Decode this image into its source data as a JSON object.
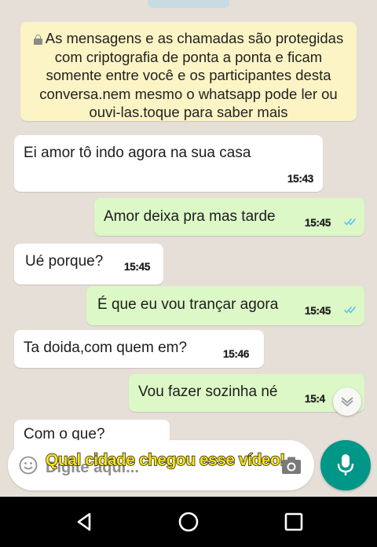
{
  "notice": {
    "text": "As mensagens e as chamadas são protegidas com criptografia de ponta a ponta e ficam somente entre você e os participantes desta conversa.nem mesmo o whatsapp pode ler ou ouvi-las.toque para saber mais"
  },
  "messages": [
    {
      "direction": "in",
      "text": "Ei amor tô indo agora na sua casa",
      "time": "15:43"
    },
    {
      "direction": "out",
      "text": "Amor deixa pra mas tarde",
      "time": "15:45",
      "status": "read"
    },
    {
      "direction": "in",
      "text": "Ué porque?",
      "time": "15:45"
    },
    {
      "direction": "out",
      "text": "É que eu vou trançar agora",
      "time": "15:45",
      "status": "read"
    },
    {
      "direction": "in",
      "text": "Ta doida,com quem em?",
      "time": "15:46"
    },
    {
      "direction": "out",
      "text": "Vou fazer sozinha né",
      "time": "15:4",
      "status": "read"
    },
    {
      "direction": "in",
      "text": "Com o que?",
      "time": ""
    }
  ],
  "composer": {
    "placeholder": "Digite aqui...",
    "overlay_caption": "Qual cidade chegou esse vídeo!"
  },
  "colors": {
    "incoming_bubble": "#ffffff",
    "outgoing_bubble": "#dcf8c6",
    "notice_bg": "#fcf4c4",
    "read_ticks": "#4fc3f7",
    "mic_button": "#009688",
    "caption": "#f7e21b"
  },
  "icons": {
    "notice": "lock-icon",
    "status": "double-check-icon",
    "scroll": "chevron-down-icon",
    "composer_left": "emoji-icon",
    "composer_right": "camera-icon",
    "send": "mic-icon",
    "nav": [
      "back-triangle-icon",
      "home-circle-icon",
      "recents-square-icon"
    ]
  }
}
